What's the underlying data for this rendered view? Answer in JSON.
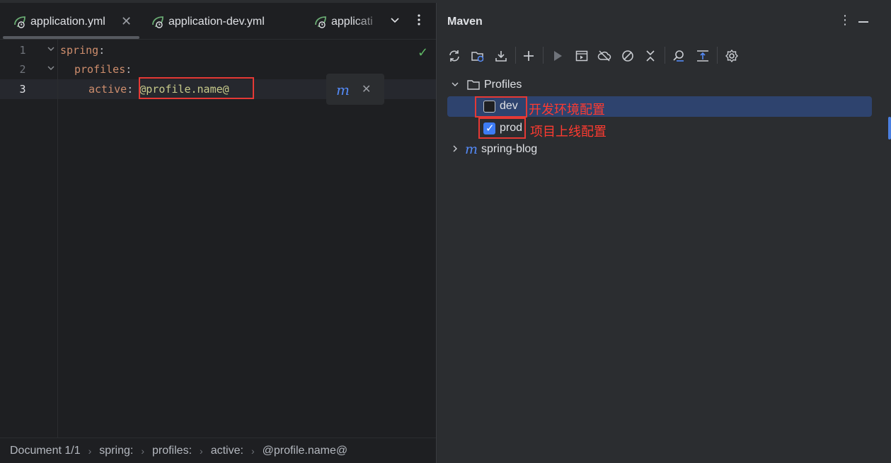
{
  "editor": {
    "tabs": [
      {
        "label": "application.yml",
        "active": true,
        "close": "✕"
      },
      {
        "label": "application-dev.yml",
        "active": false
      },
      {
        "label": "applicati",
        "active": false
      }
    ],
    "tab_overflow_icon": "chevron-down-icon",
    "tab_menu_icon": "more-vertical-icon",
    "status_check": "✓",
    "lines": [
      {
        "num": "1",
        "indent": "",
        "key": "spring",
        "colon": ":",
        "value": ""
      },
      {
        "num": "2",
        "indent": "  ",
        "key": "profiles",
        "colon": ":",
        "value": ""
      },
      {
        "num": "3",
        "indent": "    ",
        "key": "active",
        "colon": ":",
        "value": "@profile.name@"
      }
    ],
    "popup": {
      "icon": "m",
      "close": "✕"
    },
    "breadcrumb": [
      "Document 1/1",
      "spring:",
      "profiles:",
      "active:",
      "@profile.name@"
    ],
    "breadcrumb_sep": "›"
  },
  "maven": {
    "title": "Maven",
    "menu_icon": "⋮",
    "toolbar": [
      "reload-icon",
      "reimport-folder-icon",
      "download-icon",
      "add-icon",
      "run-icon",
      "execute-goal-icon",
      "offline-icon",
      "skip-tests-icon",
      "collapse-icon",
      "analyze-icon",
      "expand-all-icon",
      "settings-icon"
    ],
    "tree": {
      "profiles_label": "Profiles",
      "profiles": [
        {
          "name": "dev",
          "checked": false,
          "note": "开发环境配置"
        },
        {
          "name": "prod",
          "checked": true,
          "note": "项目上线配置"
        }
      ],
      "project_icon": "m",
      "project_label": "spring-blog"
    }
  },
  "colors": {
    "background": "#1e1f22",
    "panel": "#2b2d30",
    "yaml_key": "#cf8e6d",
    "yaml_value": "#c7ca8b",
    "selection": "#2e436e",
    "annotation_red": "#e53935",
    "checkbox_blue": "#3d7cf5"
  }
}
